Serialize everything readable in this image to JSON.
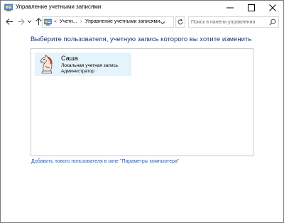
{
  "window": {
    "title": "Управление учетными записями",
    "controls": [
      "minimize",
      "maximize",
      "close"
    ]
  },
  "address": {
    "overflow_chevron": "«",
    "crumbs": [
      "Учетн...",
      "Управление учетными записями"
    ],
    "separator": "›"
  },
  "search": {
    "placeholder": "Поиск в панели управления"
  },
  "main": {
    "heading": "Выберите пользователя, учетную запись которого вы хотите изменить",
    "users": [
      {
        "name": "Саша",
        "type": "Локальная учетная запись",
        "role": "Администратор",
        "avatar_icon": "chess-knight-avatar-icon"
      }
    ],
    "add_user_link": "Добавить нового пользователя в окне \"Параметры компьютера\""
  },
  "colors": {
    "heading": "#1e3287",
    "link": "#1e64c8",
    "selection": "#e5f3fb"
  }
}
